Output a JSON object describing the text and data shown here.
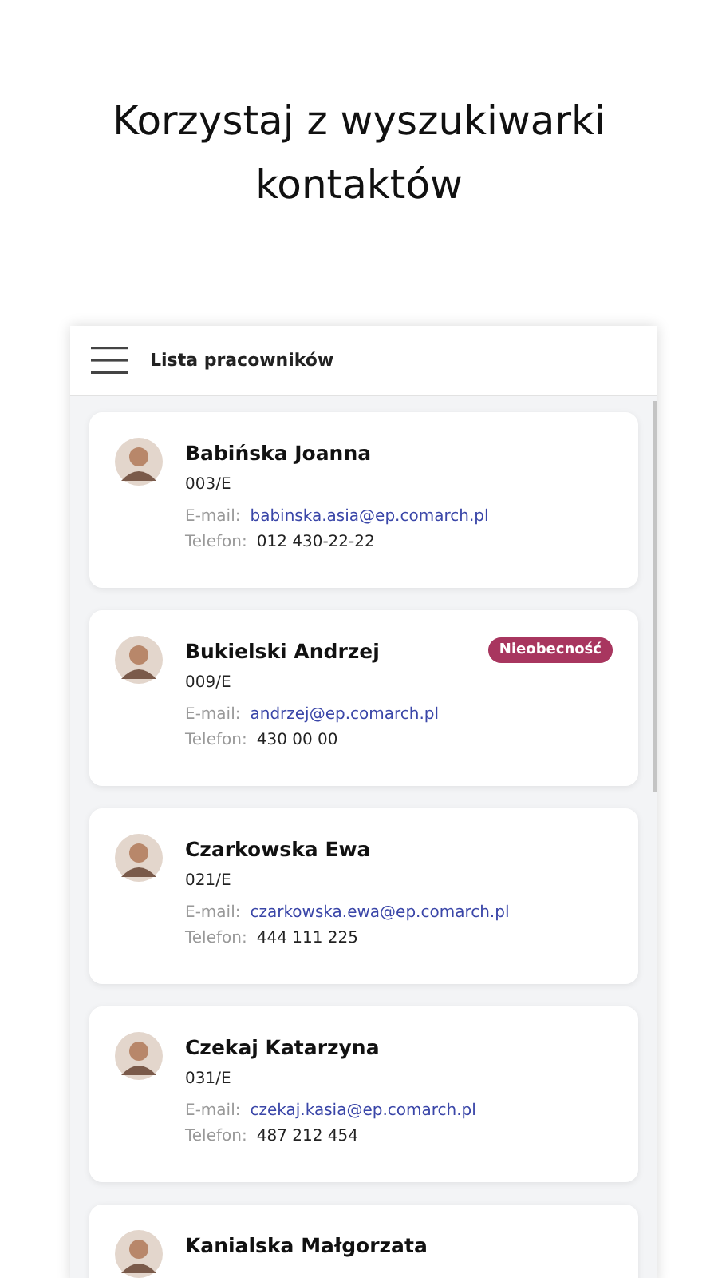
{
  "headline": "Korzystaj z wyszukiwarki kontaktów",
  "header": {
    "title": "Lista pracowników"
  },
  "employees": [
    {
      "name": "Babińska Joanna",
      "code": "003/E",
      "email_label": "E-mail:",
      "email": "babinska.asia@ep.comarch.pl",
      "phone_label": "Telefon:",
      "phone": "012 430-22-22"
    },
    {
      "name": "Bukielski Andrzej",
      "code": "009/E",
      "email_label": "E-mail:",
      "email": "andrzej@ep.comarch.pl",
      "phone_label": "Telefon:",
      "phone": "430 00 00",
      "badge": "Nieobecność"
    },
    {
      "name": "Czarkowska Ewa",
      "code": "021/E",
      "email_label": "E-mail:",
      "email": "czarkowska.ewa@ep.comarch.pl",
      "phone_label": "Telefon:",
      "phone": "444 111 225"
    },
    {
      "name": "Czekaj Katarzyna",
      "code": "031/E",
      "email_label": "E-mail:",
      "email": "czekaj.kasia@ep.comarch.pl",
      "phone_label": "Telefon:",
      "phone": "487 212 454"
    },
    {
      "name": "Kanialska Małgorzata"
    }
  ]
}
